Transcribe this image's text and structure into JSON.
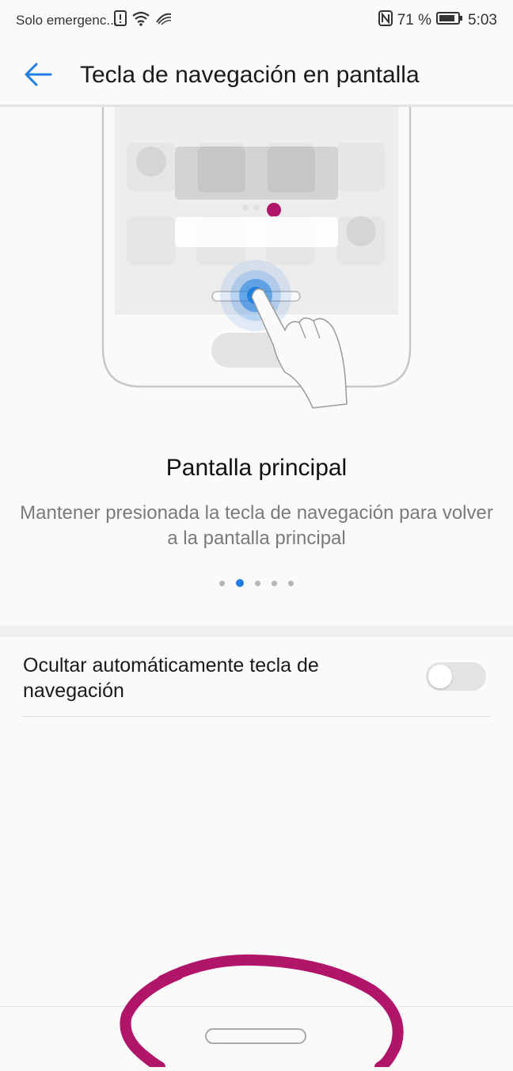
{
  "status_bar": {
    "carrier": "Solo emergenc...",
    "battery_percent": "71 %",
    "time": "5:03",
    "icons": [
      "sim-alert-icon",
      "wifi-icon",
      "swype-icon",
      "nfc-icon",
      "battery-icon"
    ]
  },
  "header": {
    "back_icon": "arrow-left-icon",
    "title": "Tecla de navegación en pantalla"
  },
  "tutorial": {
    "title": "Pantalla principal",
    "description": "Mantener presionada la tecla de navegación para volver a la pantalla principal",
    "pages": 5,
    "active_page": 2
  },
  "settings": {
    "auto_hide_label": "Ocultar automáticamente tecla de navegación",
    "auto_hide_enabled": false
  },
  "colors": {
    "accent": "#1e7fe0",
    "annotation": "#b0156a",
    "dot_highlight": "#b0156a"
  }
}
